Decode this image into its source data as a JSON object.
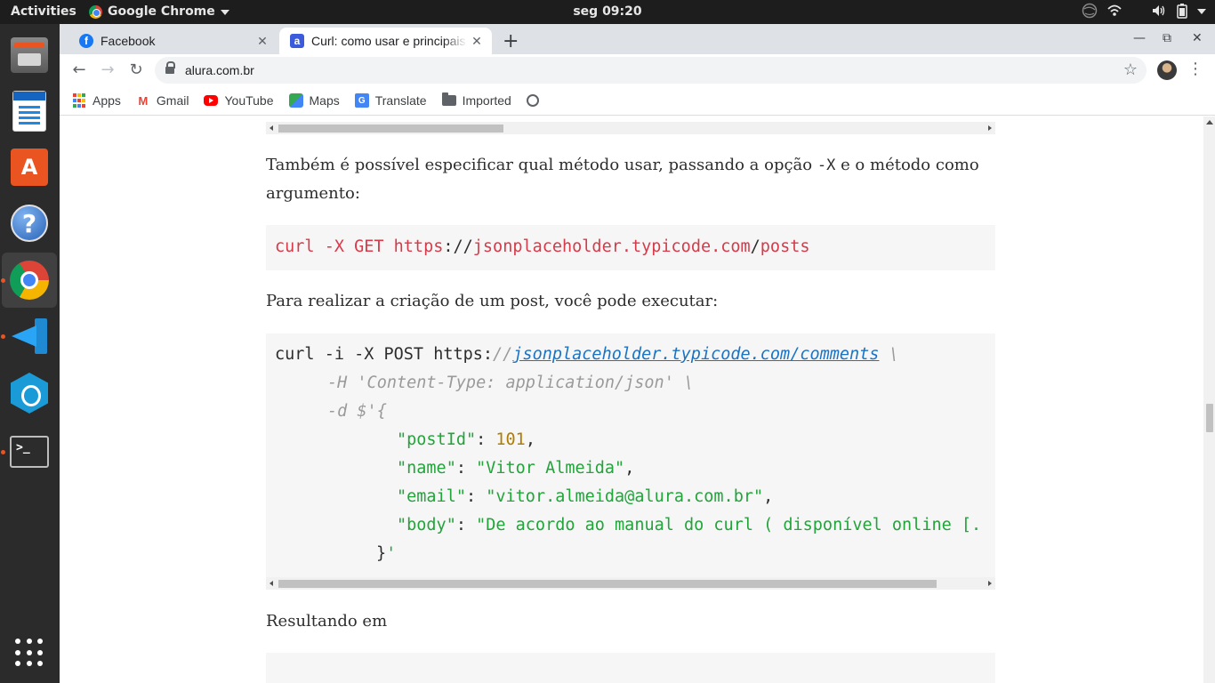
{
  "topbar": {
    "activities": "Activities",
    "app_menu": "Google Chrome",
    "clock": "seg 09:20"
  },
  "dock": {
    "items": [
      "files",
      "libreoffice-writer",
      "software-center",
      "help",
      "google-chrome",
      "vscode",
      "hex-app",
      "terminal",
      "show-applications"
    ]
  },
  "browser": {
    "tabs": [
      {
        "title": "Facebook",
        "active": false
      },
      {
        "title": "Curl: como usar e principais comandos",
        "active": true
      }
    ],
    "new_tab": "+",
    "tab_close": "✕",
    "window_controls": {
      "minimize": "—",
      "maximize": "⧉",
      "close": "✕"
    },
    "url": "alura.com.br",
    "bookmarks": [
      "Apps",
      "Gmail",
      "YouTube",
      "Maps",
      "Translate",
      "Imported"
    ]
  },
  "article": {
    "para1": "Também é possível especificar qual método usar, passando a opção",
    "para1_code": "-X",
    "para1_tail": "e o método como argumento:",
    "code1": {
      "cmd": "curl -X GET https",
      "sep1": "://",
      "host": "jsonplaceholder.typicode.com",
      "sep2": "/",
      "path": "posts"
    },
    "para2": "Para realizar a criação de um post, você pode executar:",
    "code2": {
      "line1_cmd": "curl -i -X POST https:",
      "line1_slashes": "//",
      "line1_link": "jsonplaceholder.typicode.com/comments",
      "line1_cont": " \\",
      "line2": "-H 'Content-Type: application/json' \\",
      "line3": "-d $'{",
      "postId_key": "\"postId\"",
      "postId_val": "101",
      "name_key": "\"name\"",
      "name_val": "\"Vitor Almeida\"",
      "email_key": "\"email\"",
      "email_val": "\"vitor.almeida@alura.com.br\"",
      "body_key": "\"body\"",
      "body_val": "\"De acordo ao manual do curl ( disponível online [.",
      "close_brace": "}",
      "close_quote": "'",
      "colon": ": ",
      "comma": ","
    },
    "para3": "Resultando em"
  }
}
